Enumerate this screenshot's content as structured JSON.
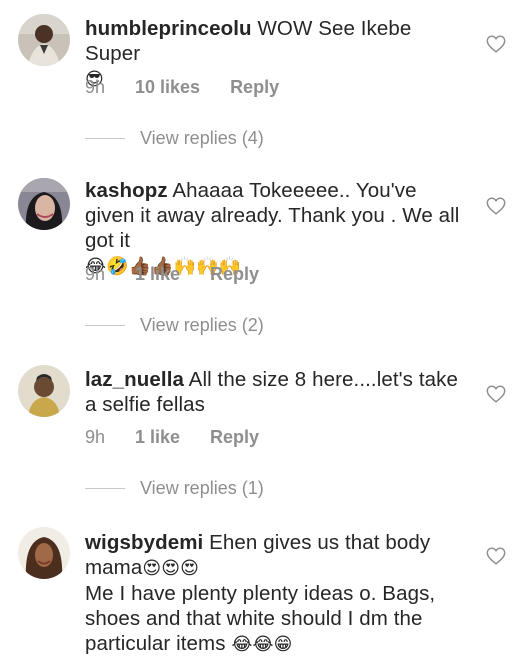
{
  "comments": [
    {
      "username": "humbleprinceolu",
      "text": "WOW See Ikebe Super",
      "emoji": "😎",
      "time": "9h",
      "likes": "10 likes",
      "reply": "Reply",
      "view_replies": "View replies (4)"
    },
    {
      "username": "kashopz",
      "text": "Ahaaaa Tokeeeee.. You've given it away already. Thank you . We all got it",
      "emoji": "😂🤣👍🏾👍🏾🙌🙌🙌",
      "time": "9h",
      "likes": "1 like",
      "reply": "Reply",
      "view_replies": "View replies (2)"
    },
    {
      "username": "laz_nuella",
      "text": "All the size 8 here....let's take a selfie fellas",
      "emoji": "",
      "time": "9h",
      "likes": "1 like",
      "reply": "Reply",
      "view_replies": "View replies (1)"
    },
    {
      "username": "wigsbydemi",
      "text": "Ehen gives us that body mama",
      "emoji": "😍😍😍",
      "text2": "Me I have plenty plenty ideas o. Bags, shoes and that white should I dm the particular items",
      "emoji2": "😂😂😁"
    }
  ],
  "icons": {
    "like": "heart-outline-icon"
  },
  "colors": {
    "text": "#262626",
    "secondary": "#8e8e8e",
    "divider": "#c7c7c7"
  }
}
